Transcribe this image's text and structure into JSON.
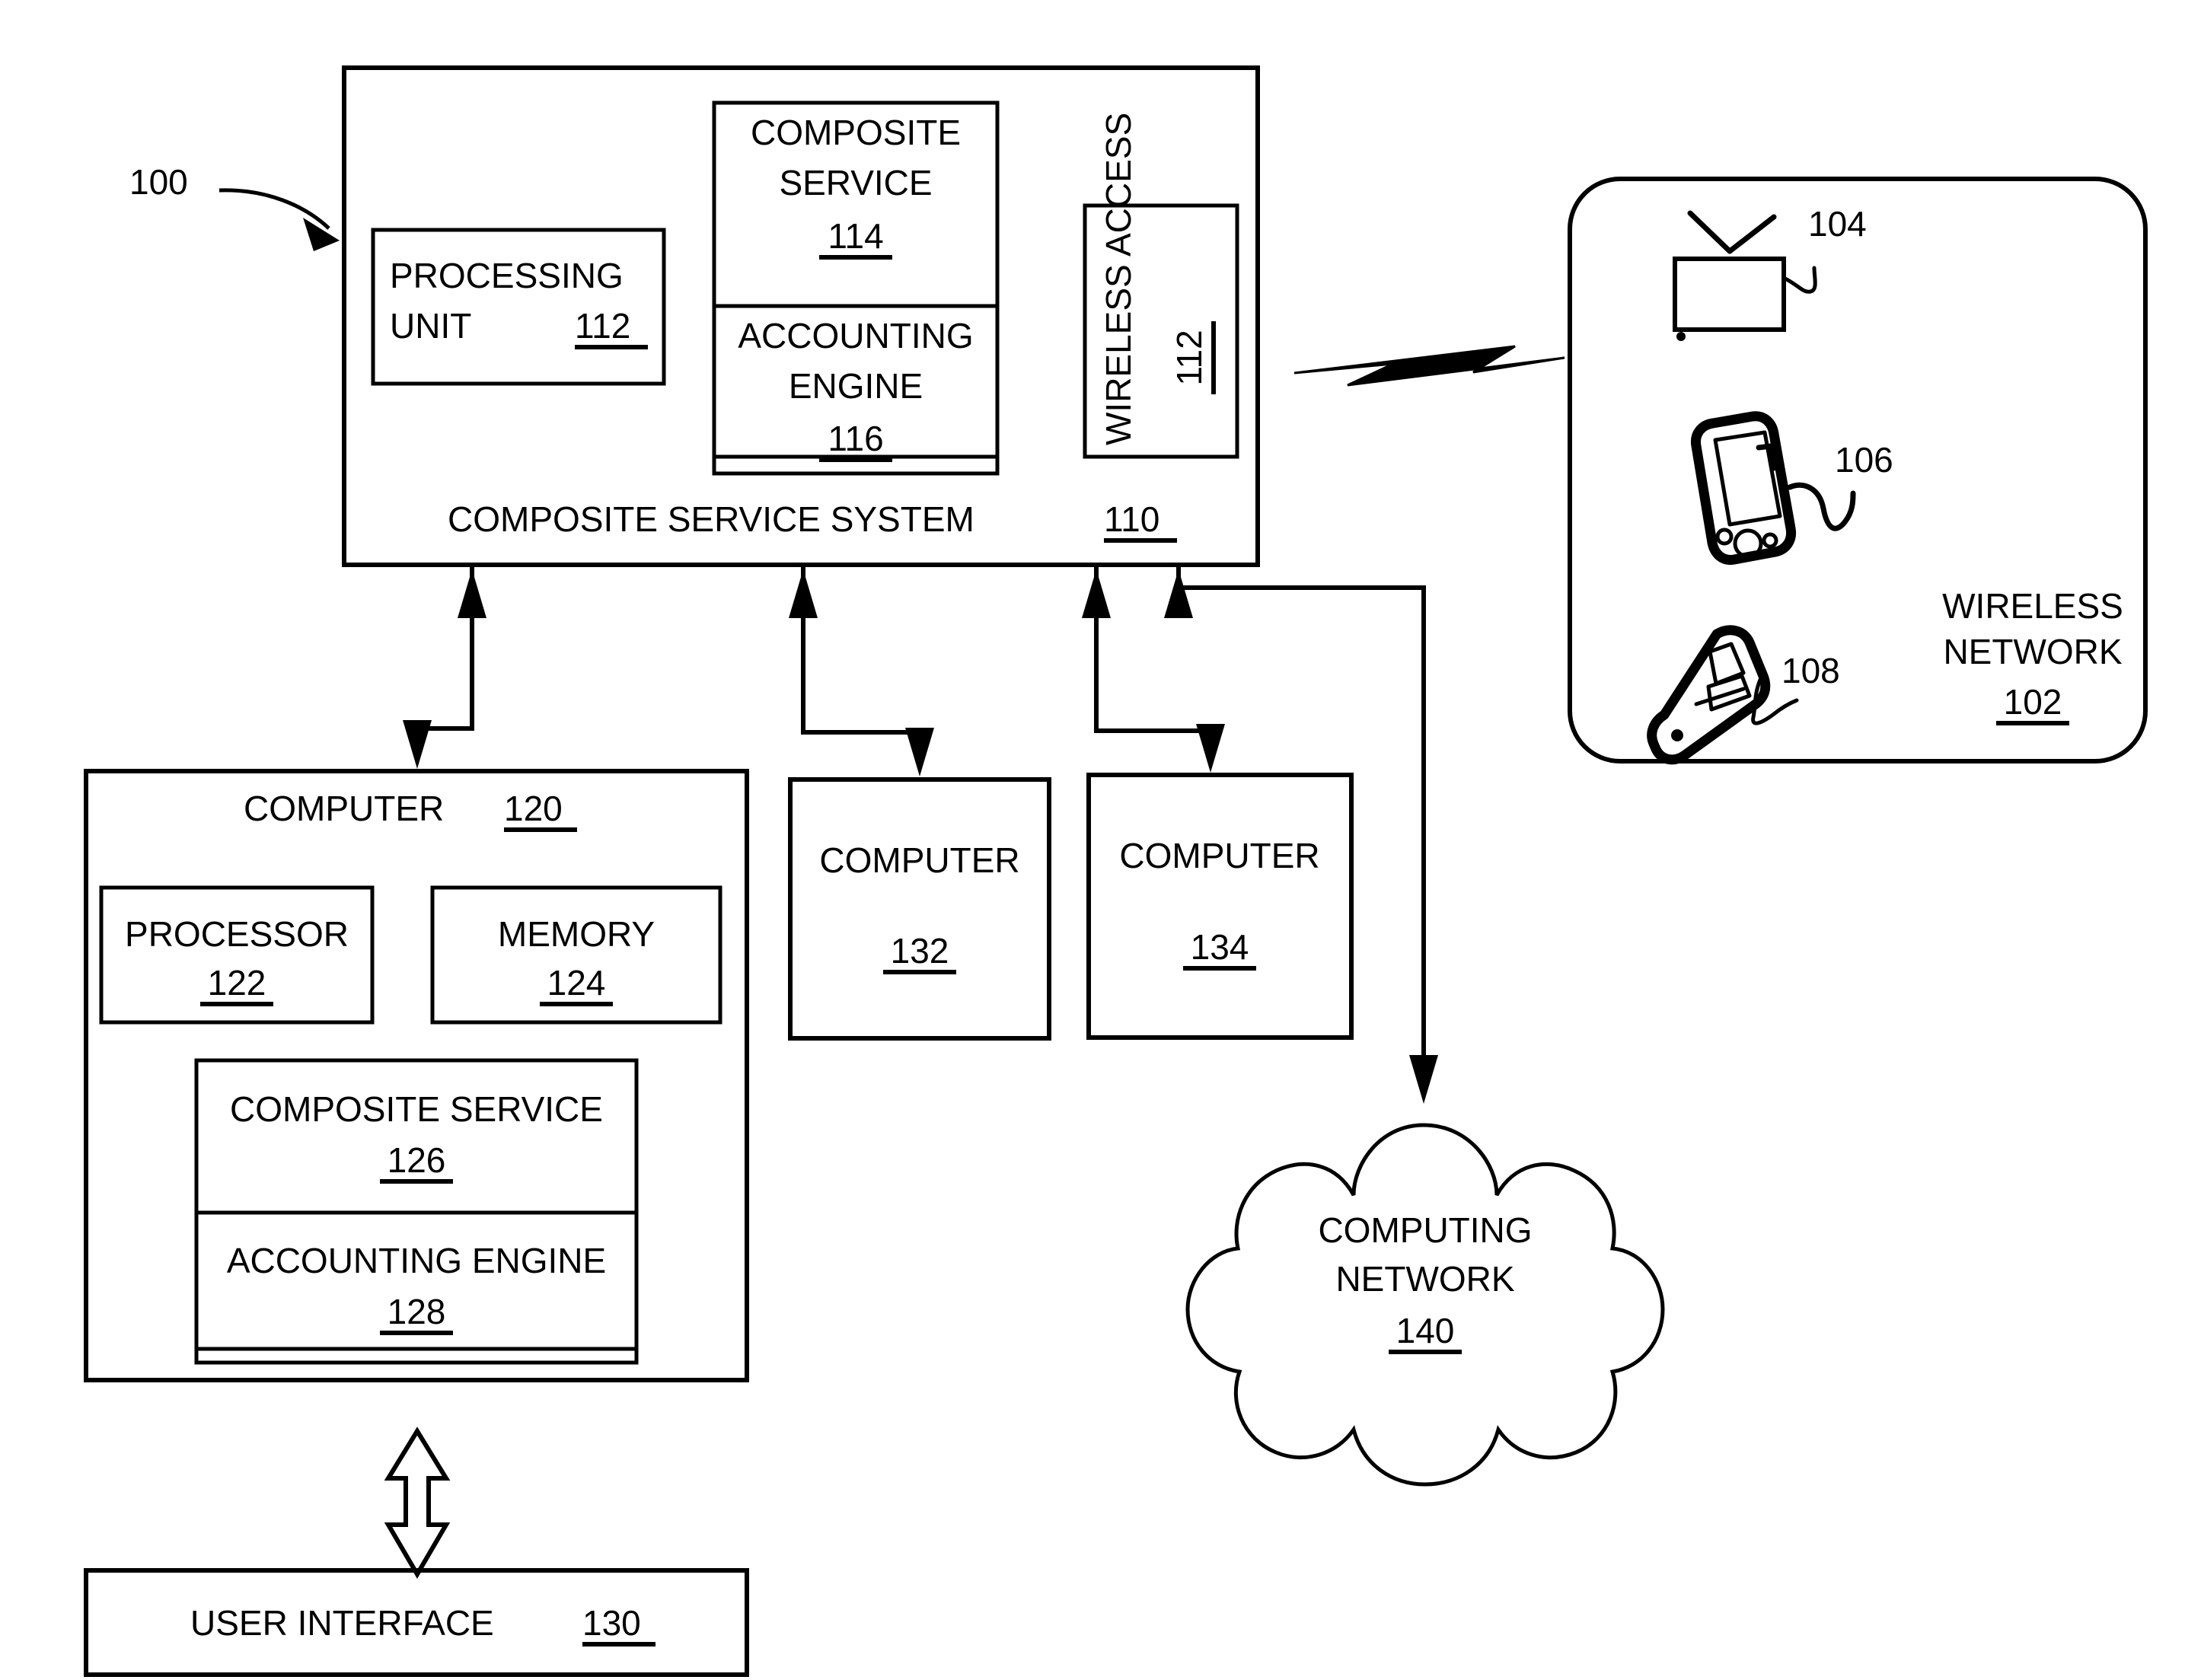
{
  "figure": {
    "reference_numeral": "100",
    "title": "Composite service system architecture block diagram"
  },
  "composite_service_system": {
    "label": "COMPOSITE SERVICE SYSTEM",
    "ref": "110",
    "processing_unit": {
      "line1": "PROCESSING",
      "line2": "UNIT",
      "ref": "112"
    },
    "composite_service": {
      "line1": "COMPOSITE",
      "line2": "SERVICE",
      "ref": "114"
    },
    "accounting_engine": {
      "line1": "ACCOUNTING",
      "line2": "ENGINE",
      "ref": "116"
    },
    "wireless_access": {
      "label": "WIRELESS ACCESS",
      "ref": "112"
    }
  },
  "wireless_network": {
    "line1": "WIRELESS",
    "line2": "NETWORK",
    "ref": "102",
    "devices": [
      {
        "icon": "television-icon",
        "ref": "104"
      },
      {
        "icon": "pda-icon",
        "ref": "106"
      },
      {
        "icon": "flip-phone-icon",
        "ref": "108"
      }
    ]
  },
  "computer_120": {
    "label": "COMPUTER",
    "ref": "120",
    "processor": {
      "label": "PROCESSOR",
      "ref": "122"
    },
    "memory": {
      "label": "MEMORY",
      "ref": "124"
    },
    "composite_service": {
      "label": "COMPOSITE SERVICE",
      "ref": "126"
    },
    "accounting_engine": {
      "label": "ACCOUNTING ENGINE",
      "ref": "128"
    }
  },
  "computer_132": {
    "label": "COMPUTER",
    "ref": "132"
  },
  "computer_134": {
    "label": "COMPUTER",
    "ref": "134"
  },
  "user_interface": {
    "label": "USER INTERFACE",
    "ref": "130"
  },
  "computing_network": {
    "line1": "COMPUTING",
    "line2": "NETWORK",
    "ref": "140"
  },
  "colors": {
    "ink": "#000000",
    "paper": "#ffffff"
  }
}
